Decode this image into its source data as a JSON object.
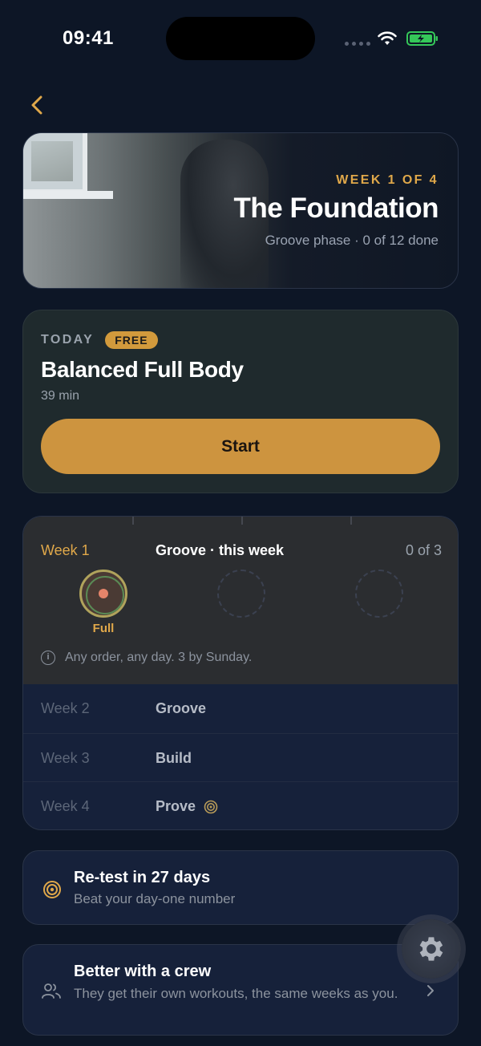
{
  "status_bar": {
    "time": "09:41"
  },
  "hero": {
    "week": "WEEK 1 OF 4",
    "title": "The Foundation",
    "subtitle": "Groove phase · 0 of 12 done"
  },
  "today": {
    "label": "TODAY",
    "badge": "FREE",
    "title": "Balanced Full Body",
    "duration": "39 min",
    "start_label": "Start"
  },
  "weeks": {
    "current": {
      "label": "Week 1",
      "phase": "Groove · this week",
      "count": "0 of 3",
      "slot_label": "Full",
      "info": "Any order, any day. 3 by Sunday."
    },
    "rows": [
      {
        "week": "Week 2",
        "phase": "Groove"
      },
      {
        "week": "Week 3",
        "phase": "Build"
      },
      {
        "week": "Week 4",
        "phase": "Prove"
      }
    ]
  },
  "retest": {
    "title": "Re-test in 27 days",
    "subtitle": "Beat your day-one number"
  },
  "crew": {
    "title": "Better with a crew",
    "subtitle": "They get their own workouts, the same weeks as you."
  },
  "colors": {
    "accent": "#e0a84a",
    "button": "#cd943f",
    "background": "#0d1626"
  },
  "icons": [
    "back-chevron-icon",
    "info-icon",
    "target-icon",
    "users-icon",
    "chevron-right-icon",
    "gear-icon",
    "wifi-icon",
    "battery-icon"
  ]
}
